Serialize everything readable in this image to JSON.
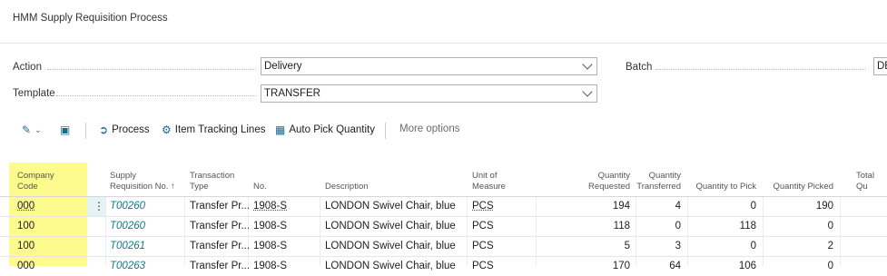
{
  "page": {
    "title": "HMM Supply Requisition Process"
  },
  "fields": {
    "action": {
      "label": "Action",
      "value": "Delivery"
    },
    "template": {
      "label": "Template",
      "value": "TRANSFER"
    },
    "batch": {
      "label": "Batch",
      "value": "DE"
    }
  },
  "toolbar": {
    "process": "Process",
    "item_tracking": "Item Tracking Lines",
    "auto_pick": "Auto Pick Quantity",
    "more": "More options"
  },
  "table": {
    "headers": {
      "company_code": [
        "Company",
        "Code"
      ],
      "supply_req_no": [
        "Supply",
        "Requisition No. ↑"
      ],
      "transaction_type": [
        "Transaction",
        "Type"
      ],
      "no": [
        "No."
      ],
      "description": [
        "Description"
      ],
      "unit": [
        "Unit of",
        "Measure"
      ],
      "qty_requested": [
        "Quantity",
        "Requested"
      ],
      "qty_transferred": [
        "Quantity",
        "Transferred"
      ],
      "qty_to_pick": [
        "Quantity to Pick"
      ],
      "qty_picked": [
        "Quantity Picked"
      ],
      "total_qty": [
        "Total Qu"
      ]
    },
    "rows": [
      {
        "company_code": "000",
        "supply_req_no": "T00260",
        "transaction_type": "Transfer Pr...",
        "no": "1908-S",
        "description": "LONDON Swivel Chair, blue",
        "unit": "PCS",
        "qty_requested": "194",
        "qty_transferred": "4",
        "qty_to_pick": "0",
        "qty_picked": "190"
      },
      {
        "company_code": "100",
        "supply_req_no": "T00260",
        "transaction_type": "Transfer Pr...",
        "no": "1908-S",
        "description": "LONDON Swivel Chair, blue",
        "unit": "PCS",
        "qty_requested": "118",
        "qty_transferred": "0",
        "qty_to_pick": "118",
        "qty_picked": "0"
      },
      {
        "company_code": "100",
        "supply_req_no": "T00261",
        "transaction_type": "Transfer Pr...",
        "no": "1908-S",
        "description": "LONDON Swivel Chair, blue",
        "unit": "PCS",
        "qty_requested": "5",
        "qty_transferred": "3",
        "qty_to_pick": "0",
        "qty_picked": "2"
      },
      {
        "company_code": "000",
        "supply_req_no": "T00263",
        "transaction_type": "Transfer Pr...",
        "no": "1908-S",
        "description": "LONDON Swivel Chair, blue",
        "unit": "PCS",
        "qty_requested": "170",
        "qty_transferred": "64",
        "qty_to_pick": "106",
        "qty_picked": "0"
      }
    ]
  }
}
